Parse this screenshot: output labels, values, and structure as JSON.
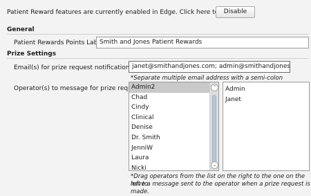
{
  "banner": {
    "text": "Patient Reward features are currently enabled in Edge.  Click here to disable.",
    "button_label": "Disable"
  },
  "general": {
    "heading": "General",
    "points_label": "Patient Rewards Points Label:",
    "points_value": "Smith and Jones Patient Rewards"
  },
  "prize": {
    "heading": "Prize Settings",
    "email_label": "Email(s) for prize request notifications:",
    "email_value": "janet@smithandjones.com; admin@smithandjones.com",
    "email_hint": "*Separate multiple email address with a semi-colon",
    "operator_label": "Operator(s) to message for prize requests:",
    "available_operators": [
      "Admin2",
      "Chad",
      "Cindy",
      "Clinical",
      "Denise",
      "Dr. Smith",
      "JenniW",
      "Laura",
      "Nicki"
    ],
    "selected_operators": [
      "Admin",
      "Janet"
    ],
    "drag_hint_line1": "*Drag operators from the list on the right to the one on the left to",
    "drag_hint_line2": "have a message sent to the operator when a prize request is made."
  }
}
